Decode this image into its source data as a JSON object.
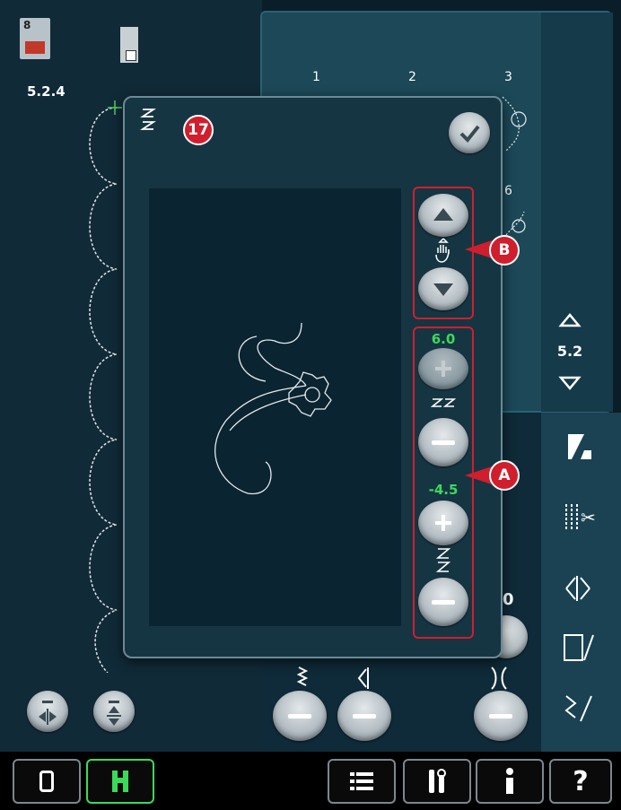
{
  "sidebar": {
    "presser_foot": "8",
    "pattern_number": "5.2.4"
  },
  "stitch_panel": {
    "stitch_numbers": [
      "1",
      "2",
      "3",
      "6"
    ],
    "nav_value": "5.2"
  },
  "dialog": {
    "badge_number": "17",
    "callout_a": "A",
    "callout_b": "B",
    "stitch_length_value": "6.0",
    "stitch_width_value": "-4.5"
  },
  "partial_value": "0",
  "colors": {
    "badge": "#d01e2c",
    "value_green": "#3bd95a",
    "accent_blue": "#1c4858"
  },
  "icons": {
    "confirm": "checkmark-icon",
    "up": "arrow-up-icon",
    "down": "arrow-down-icon",
    "plus": "plus-icon",
    "minus": "minus-icon",
    "pan": "hand-icon",
    "menu": "menu-icon",
    "tools": "tools-icon",
    "info": "info-icon",
    "help": "help-icon"
  },
  "bottom_bar": {
    "help_label": "?"
  }
}
